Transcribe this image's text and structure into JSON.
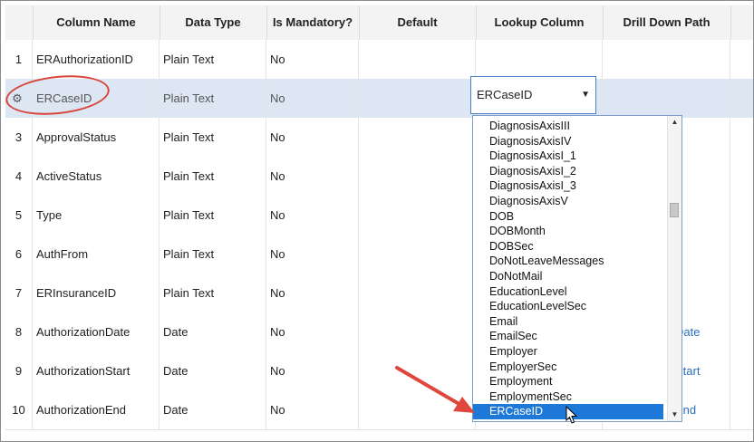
{
  "columns": {
    "num": "",
    "column_name": "Column Name",
    "data_type": "Data Type",
    "is_mandatory": "Is Mandatory?",
    "default": "Default",
    "lookup_column": "Lookup Column",
    "drill_down_path": "Drill Down Path"
  },
  "rows": [
    {
      "num": "1",
      "name": "ERAuthorizationID",
      "type": "Plain Text",
      "mandatory": "No",
      "drill": ""
    },
    {
      "num": "",
      "name": "ERCaseID",
      "type": "Plain Text",
      "mandatory": "No",
      "drill": ""
    },
    {
      "num": "3",
      "name": "ApprovalStatus",
      "type": "Plain Text",
      "mandatory": "No",
      "drill": ""
    },
    {
      "num": "4",
      "name": "ActiveStatus",
      "type": "Plain Text",
      "mandatory": "No",
      "drill": ""
    },
    {
      "num": "5",
      "name": "Type",
      "type": "Plain Text",
      "mandatory": "No",
      "drill": ""
    },
    {
      "num": "6",
      "name": "AuthFrom",
      "type": "Plain Text",
      "mandatory": "No",
      "drill": ""
    },
    {
      "num": "7",
      "name": "ERInsuranceID",
      "type": "Plain Text",
      "mandatory": "No",
      "drill": ""
    },
    {
      "num": "8",
      "name": "AuthorizationDate",
      "type": "Date",
      "mandatory": "No",
      "drill": "Date"
    },
    {
      "num": "9",
      "name": "AuthorizationStart",
      "type": "Date",
      "mandatory": "No",
      "drill": "Start"
    },
    {
      "num": "10",
      "name": "AuthorizationEnd",
      "type": "Date",
      "mandatory": "No",
      "drill": "End"
    }
  ],
  "lookup_combo": {
    "value": "ERCaseID",
    "arrow": "▼"
  },
  "dropdown": {
    "items": [
      "DiagnosisAxisIII",
      "DiagnosisAxisIV",
      "DiagnosisAxisI_1",
      "DiagnosisAxisI_2",
      "DiagnosisAxisI_3",
      "DiagnosisAxisV",
      "DOB",
      "DOBMonth",
      "DOBSec",
      "DoNotLeaveMessages",
      "DoNotMail",
      "EducationLevel",
      "EducationLevelSec",
      "Email",
      "EmailSec",
      "Employer",
      "EmployerSec",
      "Employment",
      "EmploymentSec",
      "ERCaseID"
    ],
    "selected_index": 19,
    "scroll_position": 0.28,
    "up_arrow": "▲",
    "down_arrow": "▼"
  },
  "colors": {
    "highlight_row": "#dde7f4",
    "annotation": "#d9453b",
    "selection": "#1e78d8",
    "link": "#2a6ebb"
  }
}
